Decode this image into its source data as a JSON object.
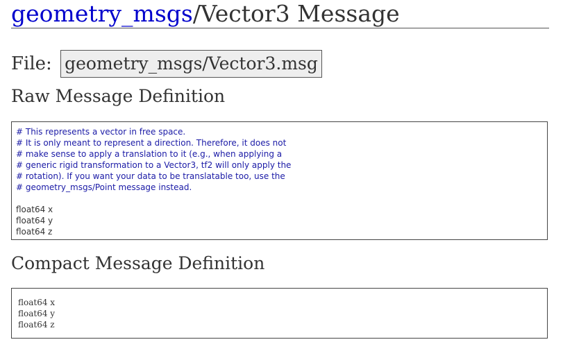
{
  "header": {
    "package_link": "geometry_msgs",
    "title_rest": "/Vector3 Message"
  },
  "file": {
    "label": "File:",
    "path": "geometry_msgs/Vector3.msg"
  },
  "raw": {
    "heading": "Raw Message Definition",
    "comments": [
      "# This represents a vector in free space.",
      "# It is only meant to represent a direction. Therefore, it does not",
      "# make sense to apply a translation to it (e.g., when applying a",
      "# generic rigid transformation to a Vector3, tf2 will only apply the",
      "# rotation). If you want your data to be translatable too, use the",
      "# geometry_msgs/Point message instead."
    ],
    "fields": [
      "float64 x",
      "float64 y",
      "float64 z"
    ]
  },
  "compact": {
    "heading": "Compact Message Definition",
    "fields": [
      "float64 x",
      "float64 y",
      "float64 z"
    ]
  }
}
